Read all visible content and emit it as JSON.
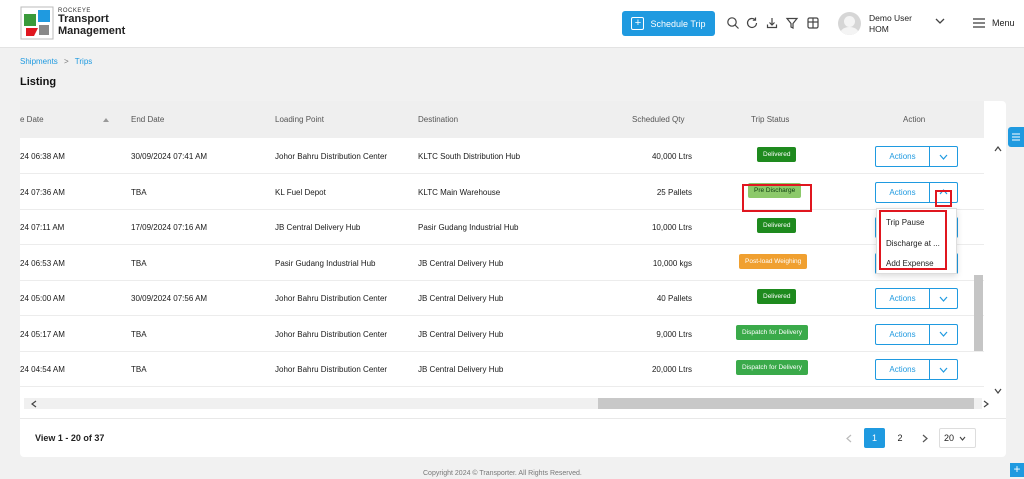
{
  "header": {
    "brand_top": "ROCKEYE",
    "brand_line1": "Transport",
    "brand_line2": "Management",
    "schedule_btn": "Schedule Trip",
    "user_name": "Demo User",
    "user_role": "HOM",
    "menu_label": "Menu"
  },
  "breadcrumb": {
    "first": "Shipments",
    "sep": ">",
    "second": "Trips"
  },
  "page_title": "Listing",
  "table": {
    "columns": [
      "e Date",
      "End Date",
      "Loading Point",
      "Destination",
      "Scheduled Qty",
      "Trip Status",
      "Action"
    ],
    "rows": [
      {
        "start": "24 06:38 AM",
        "end": "30/09/2024 07:41 AM",
        "loading": "Johor Bahru Distribution Center",
        "dest": "KLTC South Distribution Hub",
        "qty": "40,000 Ltrs",
        "status": "Delivered",
        "status_color": "#1e8a1e",
        "action": "Actions"
      },
      {
        "start": "24 07:36 AM",
        "end": "TBA",
        "loading": "KL Fuel Depot",
        "dest": "KLTC Main Warehouse",
        "qty": "25 Pallets",
        "status": "Pre Discharge",
        "status_color": "#8cc96a",
        "action": "Actions"
      },
      {
        "start": "24 07:11 AM",
        "end": "17/09/2024 07:16 AM",
        "loading": "JB Central Delivery Hub",
        "dest": "Pasir Gudang Industrial Hub",
        "qty": "10,000 Ltrs",
        "status": "Delivered",
        "status_color": "#1e8a1e",
        "action": "Actions"
      },
      {
        "start": "24 06:53 AM",
        "end": "TBA",
        "loading": "Pasir Gudang Industrial Hub",
        "dest": "JB Central Delivery Hub",
        "qty": "10,000 kgs",
        "status": "Post-load Weighing",
        "status_color": "#f0a030",
        "action": "Actions"
      },
      {
        "start": "24 05:00 AM",
        "end": "30/09/2024 07:56 AM",
        "loading": "Johor Bahru Distribution Center",
        "dest": "JB Central Delivery Hub",
        "qty": "40 Pallets",
        "status": "Delivered",
        "status_color": "#1e8a1e",
        "action": "Actions"
      },
      {
        "start": "24 05:17 AM",
        "end": "TBA",
        "loading": "Johor Bahru Distribution Center",
        "dest": "JB Central Delivery Hub",
        "qty": "9,000 Ltrs",
        "status": "Dispatch for Delivery",
        "status_color": "#3aaa4a",
        "action": "Actions"
      },
      {
        "start": "24 04:54 AM",
        "end": "TBA",
        "loading": "Johor Bahru Distribution Center",
        "dest": "JB Central Delivery Hub",
        "qty": "20,000 Ltrs",
        "status": "Dispatch for Delivery",
        "status_color": "#3aaa4a",
        "action": "Actions"
      }
    ]
  },
  "dropdown_menu": {
    "items": [
      "Trip Pause",
      "Discharge at ...",
      "Add Expense"
    ]
  },
  "pagination": {
    "view_text": "View 1 - 20 of 37",
    "pages": [
      "1",
      "2"
    ],
    "active_page": "1",
    "page_size": "20"
  },
  "footer": {
    "copyright": "Copyright 2024 © Transporter. All Rights Reserved."
  },
  "colors": {
    "accent": "#1f9ae0",
    "highlight": "#e0161f"
  }
}
